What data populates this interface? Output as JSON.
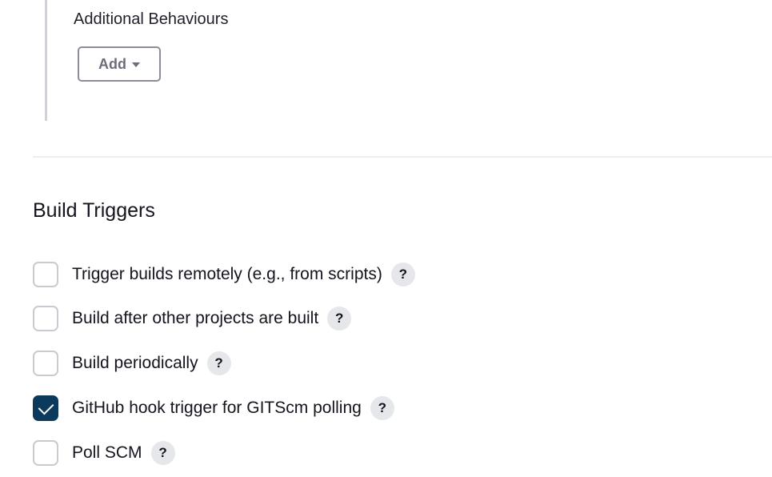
{
  "behaviours": {
    "label": "Additional Behaviours",
    "add_button_label": "Add"
  },
  "build_triggers": {
    "title": "Build Triggers",
    "help_glyph": "?",
    "items": [
      {
        "label": "Trigger builds remotely (e.g., from scripts)",
        "checked": false
      },
      {
        "label": "Build after other projects are built",
        "checked": false
      },
      {
        "label": "Build periodically",
        "checked": false
      },
      {
        "label": "GitHub hook trigger for GITScm polling",
        "checked": true
      },
      {
        "label": "Poll SCM",
        "checked": false
      }
    ]
  },
  "colors": {
    "checkbox_checked": "#0b3a5c",
    "checkbox_border": "#c9cbd2",
    "help_background": "#e6e7ea"
  },
  "icons": {
    "add_caret": "chevron-down-icon",
    "help": "help-icon",
    "checkmark": "checkmark-icon"
  }
}
